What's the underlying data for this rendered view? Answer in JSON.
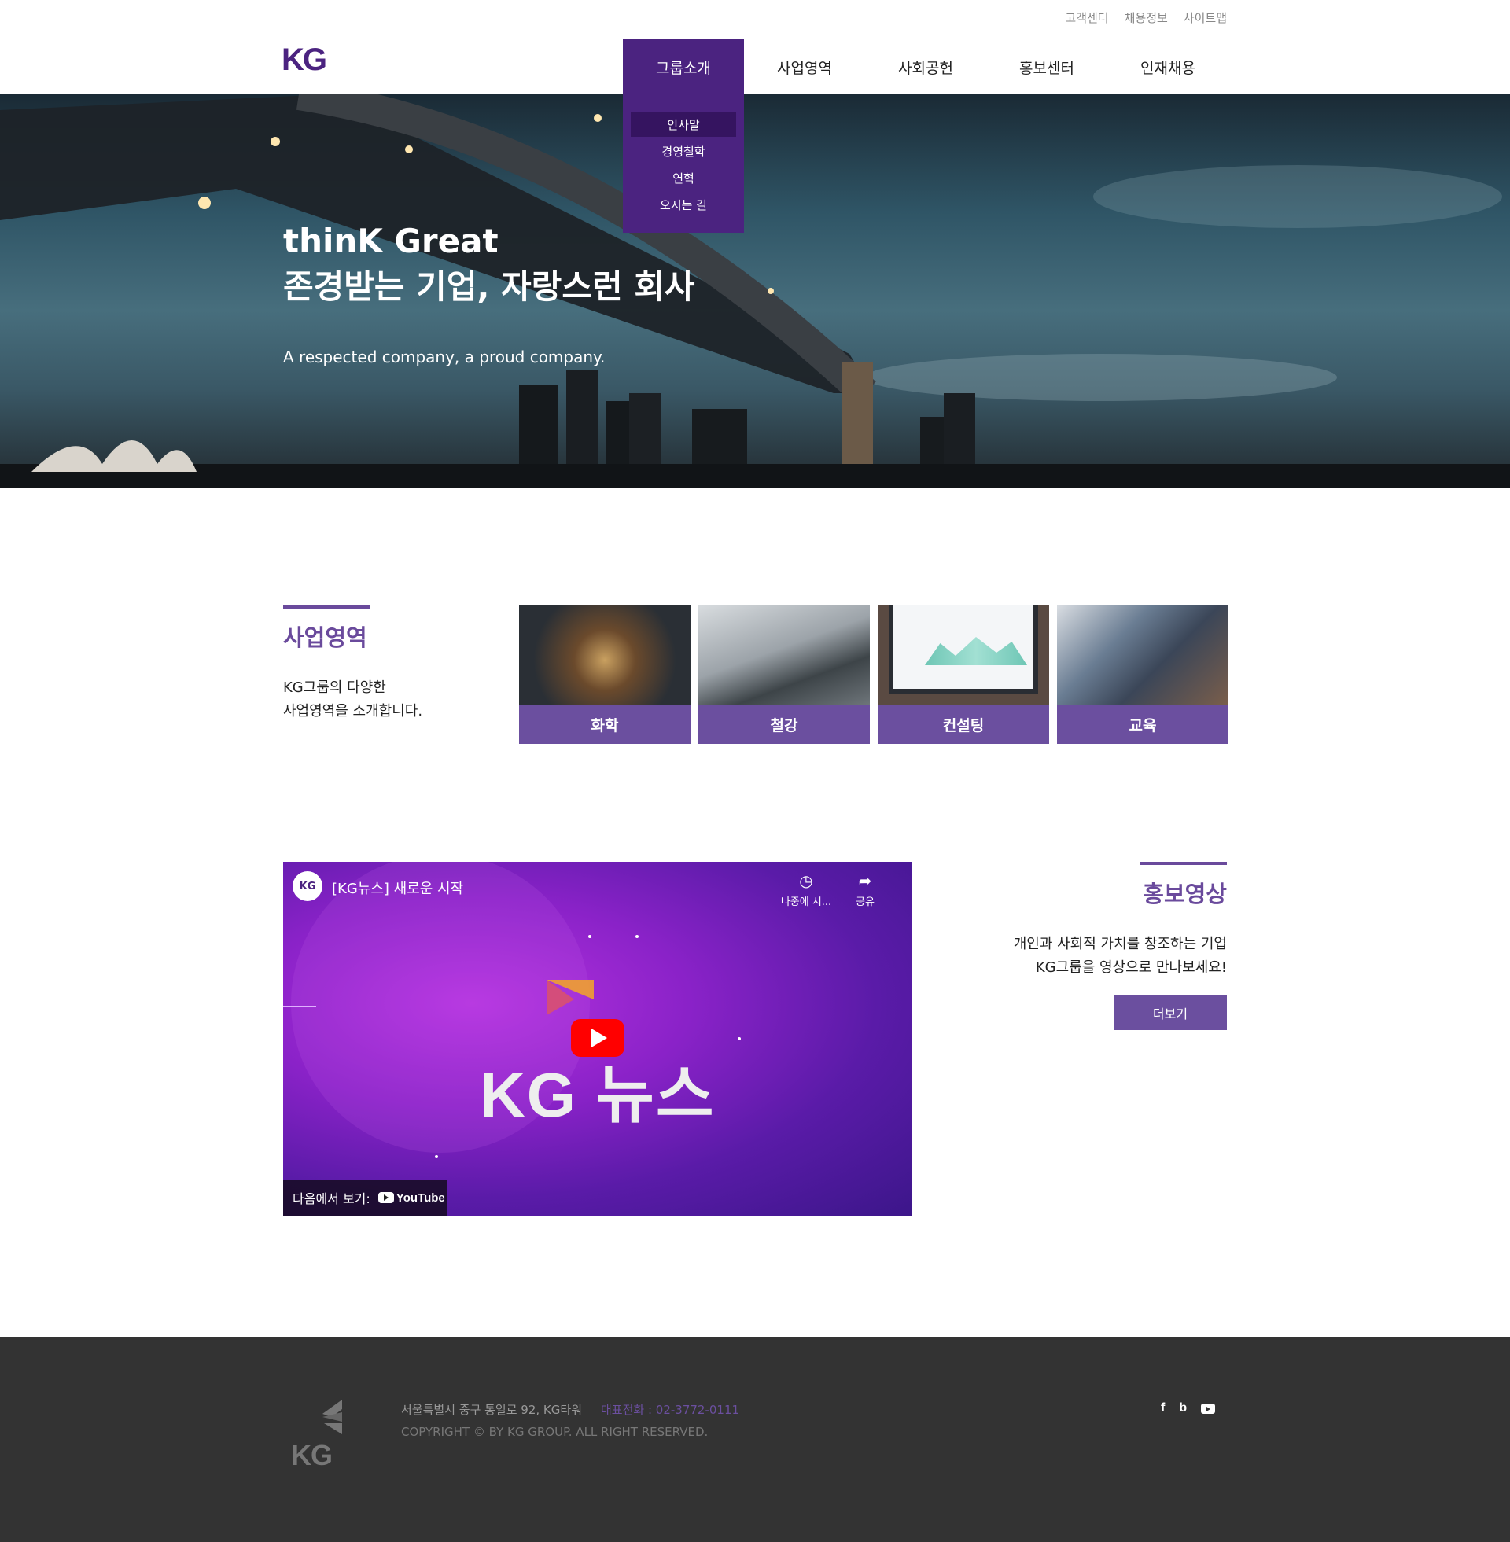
{
  "util_links": [
    "고객센터",
    "채용정보",
    "사이트맵"
  ],
  "header": {
    "logo": "KG"
  },
  "gnb": [
    "그룹소개",
    "사업영역",
    "사회공헌",
    "홍보센터",
    "인재채용"
  ],
  "submenu": [
    "인사말",
    "경영철학",
    "연혁",
    "오시는 길"
  ],
  "hero": {
    "title_line1": "thinK Great",
    "title_line2": "존경받는 기업, 자랑스런 회사",
    "subtitle": "A respected company, a proud company."
  },
  "business": {
    "title": "사업영역",
    "desc_line1": "KG그룹의 다양한",
    "desc_line2": "사업영역을 소개합니다.",
    "cards": [
      "화학",
      "철강",
      "컨설팅",
      "교육"
    ]
  },
  "video": {
    "channel": "KG",
    "title": "[KG뉴스] 새로운 시작",
    "watch_later": "나중에 시...",
    "share": "공유",
    "big_text": "KG 뉴스",
    "watch_on": "다음에서 보기:",
    "youtube": "YouTube"
  },
  "promo": {
    "title": "홍보영상",
    "desc_line1": "개인과 사회적 가치를 창조하는 기업",
    "desc_line2": "KG그룹을 영상으로 만나보세요!",
    "more": "더보기"
  },
  "footer": {
    "logo": "KG",
    "address": "서울특별시 중구 통일로 92, KG타워",
    "tel": "대표전화 : 02-3772-0111",
    "copyright": "COPYRIGHT © BY KG GROUP. ALL RIGHT RESERVED.",
    "sns": [
      "f",
      "b",
      "youtube-icon"
    ]
  },
  "colors": {
    "brand": "#4b2380",
    "accent": "#6b4f9f",
    "footer_bg": "#333333"
  }
}
